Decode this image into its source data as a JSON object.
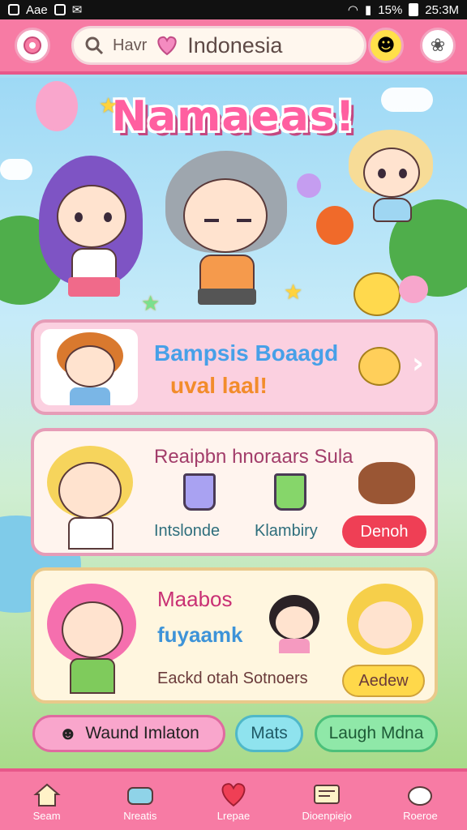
{
  "status_bar": {
    "left_text": "Aae",
    "battery": "15%",
    "time": "25:3M"
  },
  "header": {
    "search_prefix": "Havr",
    "search_value": "Indonesia"
  },
  "title": "Namaeas!",
  "cards": {
    "featured": {
      "line1": "Bampsis Boaagd",
      "line2": "uval laal!"
    },
    "shop": {
      "title": "Reaipbn hnoraars Sula",
      "item1_label": "Intslonde",
      "item2_label": "Klambiry",
      "button_label": "Denoh"
    },
    "event": {
      "title": "Maabos",
      "subtitle": "fuyaamk",
      "caption": "Eackd otah Sotnoers",
      "button_label": "Aedew"
    }
  },
  "quick_actions": {
    "one": "Waund Imlaton",
    "two": "Mats",
    "three": "Laugh Mdna"
  },
  "bottom_nav": [
    {
      "label": "Seam",
      "icon": "house-icon"
    },
    {
      "label": "Nreatis",
      "icon": "game-controller-icon"
    },
    {
      "label": "Lrepae",
      "icon": "heart-icon"
    },
    {
      "label": "Dioenpiejo",
      "icon": "message-board-icon"
    },
    {
      "label": "Roeroe",
      "icon": "pet-icon"
    }
  ],
  "colors": {
    "topbar": "#f77ba4",
    "card1_bg": "#fbd0e0",
    "card_border": "#e69cb7",
    "red_button": "#ef3f55",
    "yellow_button": "#ffd84a",
    "teal_pill": "#8fe3ee",
    "green_pill": "#8fe8a8"
  }
}
